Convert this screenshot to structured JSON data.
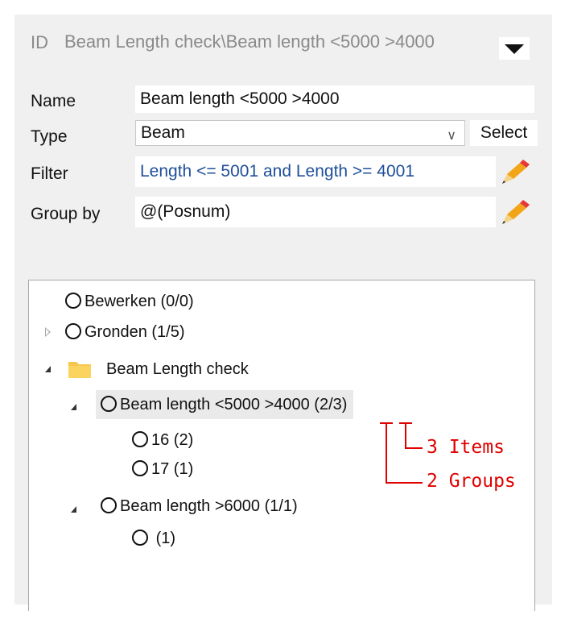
{
  "header": {
    "id_label": "ID",
    "title": "Beam Length check\\Beam length <5000 >4000"
  },
  "form": {
    "name_label": "Name",
    "name_value": "Beam length <5000 >4000",
    "type_label": "Type",
    "type_value": "Beam",
    "select_label": "Select",
    "filter_label": "Filter",
    "filter_value": "Length <= 5001 and Length >= 4001",
    "group_label": "Group by",
    "group_value": "@(Posnum)"
  },
  "tree": {
    "bewerken": "Bewerken (0/0)",
    "gronden": "Gronden (1/5)",
    "folder": "Beam Length check",
    "rule1": "Beam length <5000 >4000 (2/3)",
    "rule1_children": [
      "16 (2)",
      "17 (1)"
    ],
    "rule2": "Beam length >6000 (1/1)",
    "rule2_children": [
      "(1)"
    ]
  },
  "annotations": {
    "items": "3 Items",
    "groups": "2 Groups",
    "color": "#e00000"
  },
  "icons": [
    "dropdown-arrow-icon",
    "chevron-down-icon",
    "pencil-icon",
    "folder-icon",
    "radio-circle-icon",
    "expand-arrow-icon",
    "collapse-arrow-icon"
  ]
}
